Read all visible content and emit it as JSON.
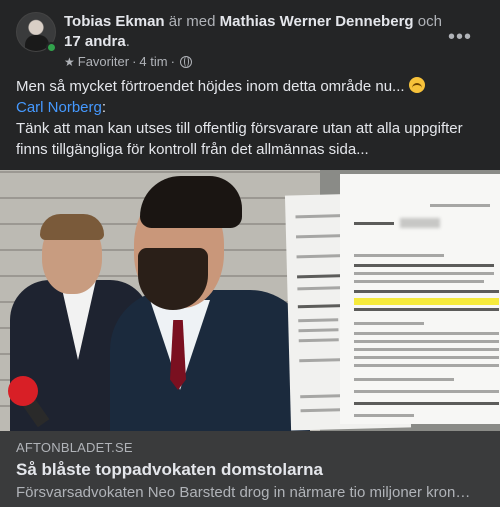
{
  "post": {
    "author": "Tobias Ekman",
    "with_text": "är med",
    "tagged_person": "Mathias Werner Denneberg",
    "and_text": "och",
    "others": "17 andra",
    "period": ".",
    "audience": "Favoriter",
    "separator": "·",
    "time": "4 tim",
    "separator2": "·",
    "more_label": "•••",
    "text_line1": "Men så mycket förtroendet höjdes inom detta område nu...",
    "mention": "Carl Norberg",
    "mention_suffix": ":",
    "text_line2": "Tänk att man kan utses till offentlig försvarare utan att alla uppgifter finns tillgängliga för kontroll från det allmännas sida..."
  },
  "link": {
    "domain": "AFTONBLADET.SE",
    "title": "Så blåste toppadvokaten domstolarna",
    "description": "Försvarsadvokaten Neo Barstedt drog in närmare tio miljoner kron…"
  },
  "colors": {
    "background": "#242526",
    "caption_bg": "#3a3b3c",
    "link_blue": "#4599ff",
    "online_green": "#31a24c",
    "highlight_yellow": "#f5ea3c"
  },
  "icons": {
    "audience": "star-icon",
    "privacy": "globe-icon",
    "reaction": "upside-down-face-emoji"
  }
}
